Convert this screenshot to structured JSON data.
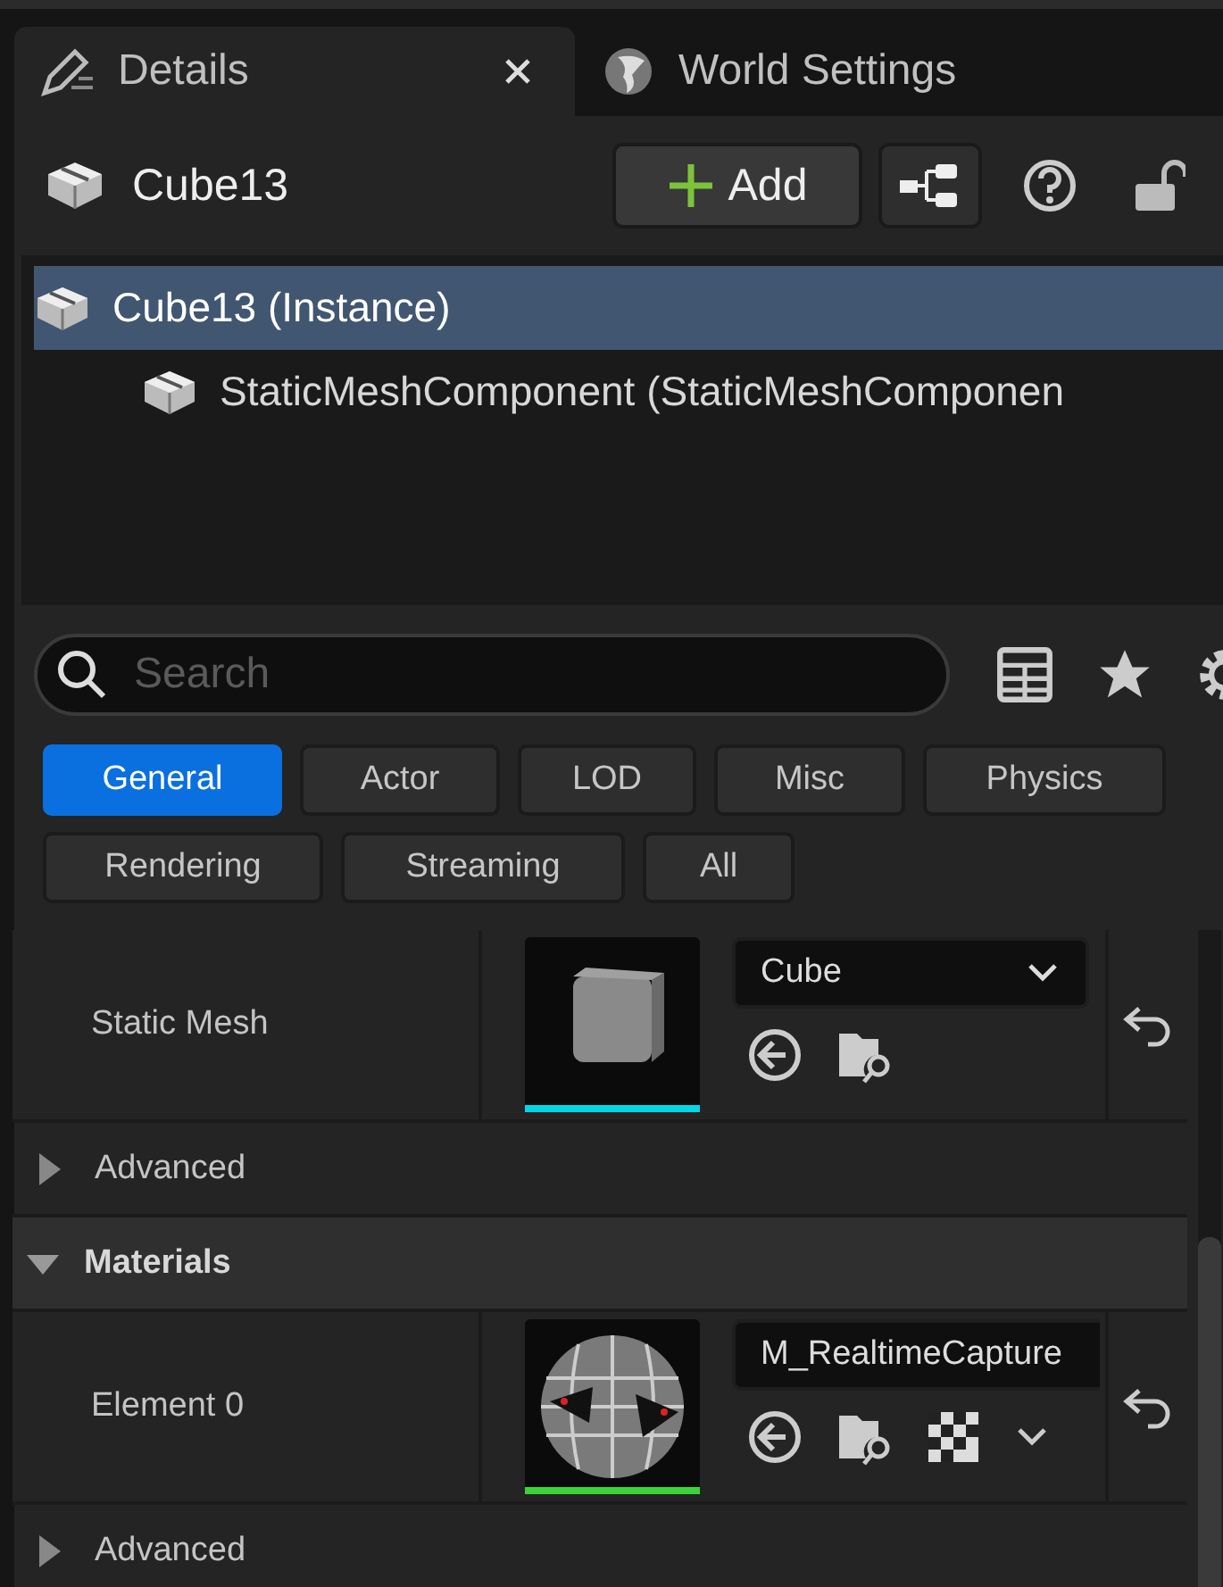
{
  "tabs": [
    {
      "label": "Details",
      "selected": true,
      "closable": true
    },
    {
      "label": "World Settings",
      "selected": false,
      "closable": false
    }
  ],
  "header": {
    "title": "Cube13",
    "add_button": "Add"
  },
  "components": [
    {
      "label": "Cube13 (Instance)",
      "selected": true,
      "children": [
        {
          "label": "StaticMeshComponent (StaticMeshComponen",
          "selected": false
        }
      ]
    }
  ],
  "search": {
    "placeholder": "Search"
  },
  "filters": [
    {
      "label": "General",
      "selected": true
    },
    {
      "label": "Actor",
      "selected": false
    },
    {
      "label": "LOD",
      "selected": false
    },
    {
      "label": "Misc",
      "selected": false
    },
    {
      "label": "Physics",
      "selected": false
    },
    {
      "label": "Rendering",
      "selected": false
    },
    {
      "label": "Streaming",
      "selected": false
    },
    {
      "label": "All",
      "selected": false
    }
  ],
  "properties": [
    {
      "kind": "asset",
      "label": "Static Mesh",
      "value": "Cube",
      "color": "#00d8e8",
      "dropdown": true,
      "texture_picker": false
    },
    {
      "kind": "advanced",
      "label": "Advanced",
      "expanded": false
    },
    {
      "kind": "category",
      "label": "Materials",
      "expanded": true
    },
    {
      "kind": "asset",
      "label": "Element 0",
      "value": "M_RealtimeCapture",
      "color": "#3ad43a",
      "dropdown": false,
      "texture_picker": true
    },
    {
      "kind": "advanced",
      "label": "Advanced",
      "expanded": false
    }
  ]
}
